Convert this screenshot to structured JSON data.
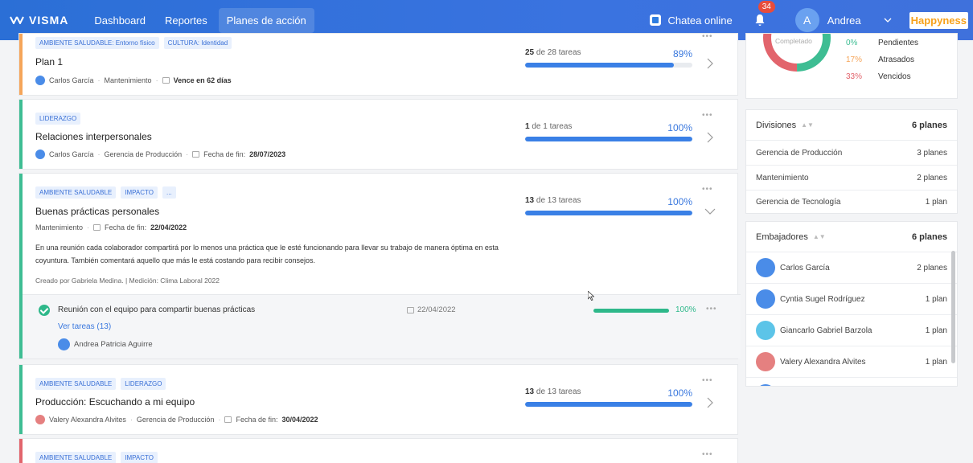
{
  "topbar": {
    "logo": "VISMA",
    "nav": [
      "Dashboard",
      "Reportes",
      "Planes de acción"
    ],
    "chat": "Chatea online",
    "notifications": "34",
    "avatar_letter": "A",
    "user": "Andrea",
    "brand": "Happyness"
  },
  "plans": [
    {
      "tags": [
        "AMBIENTE SALUDABLE: Entorno físico",
        "CULTURA: Identidad"
      ],
      "title": "Plan 1",
      "owner": "Carlos García",
      "division": "Mantenimiento",
      "due": "Vence en 62 días",
      "tasks_done": "25",
      "tasks_total_text": "de 28 tareas",
      "percent": "89%",
      "progress": 0.89
    },
    {
      "tags": [
        "LIDERAZGO"
      ],
      "title": "Relaciones interpersonales",
      "owner": "Carlos García",
      "division": "Gerencia de Producción",
      "due_label": "Fecha de fin:",
      "due": "28/07/2023",
      "tasks_done": "1",
      "tasks_total_text": "de 1 tareas",
      "percent": "100%",
      "progress": 1.0
    },
    {
      "tags": [
        "AMBIENTE SALUDABLE",
        "IMPACTO",
        "..."
      ],
      "title": "Buenas prácticas personales",
      "division": "Mantenimiento",
      "due_label": "Fecha de fin:",
      "due": "22/04/2022",
      "tasks_done": "13",
      "tasks_total_text": "de 13 tareas",
      "percent": "100%",
      "progress": 1.0,
      "description": "En una reunión cada colaborador compartirá por lo menos una práctica que le esté funcionando para llevar su trabajo de manera óptima en esta coyuntura. También comentará aquello que más le está costando para recibir consejos.",
      "created": "Creado por Gabriela Medina.  |  Medición: Clima Laboral 2022",
      "subtask": {
        "title": "Reunión con el equipo para compartir buenas prácticas",
        "date": "22/04/2022",
        "percent": "100%",
        "progress": 1.0,
        "link": "Ver tareas (13)",
        "owner": "Andrea Patricia Aguirre"
      }
    },
    {
      "tags": [
        "AMBIENTE SALUDABLE",
        "LIDERAZGO"
      ],
      "title": "Producción: Escuchando a mi equipo",
      "owner": "Valery Alexandra Alvites",
      "division": "Gerencia de Producción",
      "due_label": "Fecha de fin:",
      "due": "30/04/2022",
      "tasks_done": "13",
      "tasks_total_text": "de 13 tareas",
      "percent": "100%",
      "progress": 1.0
    },
    {
      "tags": [
        "AMBIENTE SALUDABLE",
        "IMPACTO"
      ]
    }
  ],
  "summary": {
    "donut_label": "Completado",
    "legend": [
      {
        "pct": "0%",
        "label": "Pendientes",
        "color": "#3ebd93"
      },
      {
        "pct": "17%",
        "label": "Atrasados",
        "color": "#f5a55a"
      },
      {
        "pct": "33%",
        "label": "Vencidos",
        "color": "#e2646c"
      }
    ]
  },
  "divisions": {
    "header": "Divisiones",
    "count": "6 planes",
    "rows": [
      {
        "name": "Gerencia de Producción",
        "value": "3 planes"
      },
      {
        "name": "Mantenimiento",
        "value": "2 planes"
      },
      {
        "name": "Gerencia de Tecnología",
        "value": "1 plan"
      }
    ]
  },
  "ambassadors": {
    "header": "Embajadores",
    "count": "6 planes",
    "rows": [
      {
        "name": "Carlos García",
        "value": "2 planes",
        "color": "#4a8ce8"
      },
      {
        "name": "Cyntia Sugel Rodríguez",
        "value": "1 plan",
        "color": "#4a8ce8"
      },
      {
        "name": "Giancarlo Gabriel Barzola",
        "value": "1 plan",
        "color": "#5cc4e8"
      },
      {
        "name": "Valery Alexandra Alvites",
        "value": "1 plan",
        "color": "#e58080"
      }
    ]
  },
  "colors": {
    "primary": "#3a78de",
    "green": "#3ebd93",
    "orange": "#f5a55a",
    "red": "#e2646c"
  }
}
